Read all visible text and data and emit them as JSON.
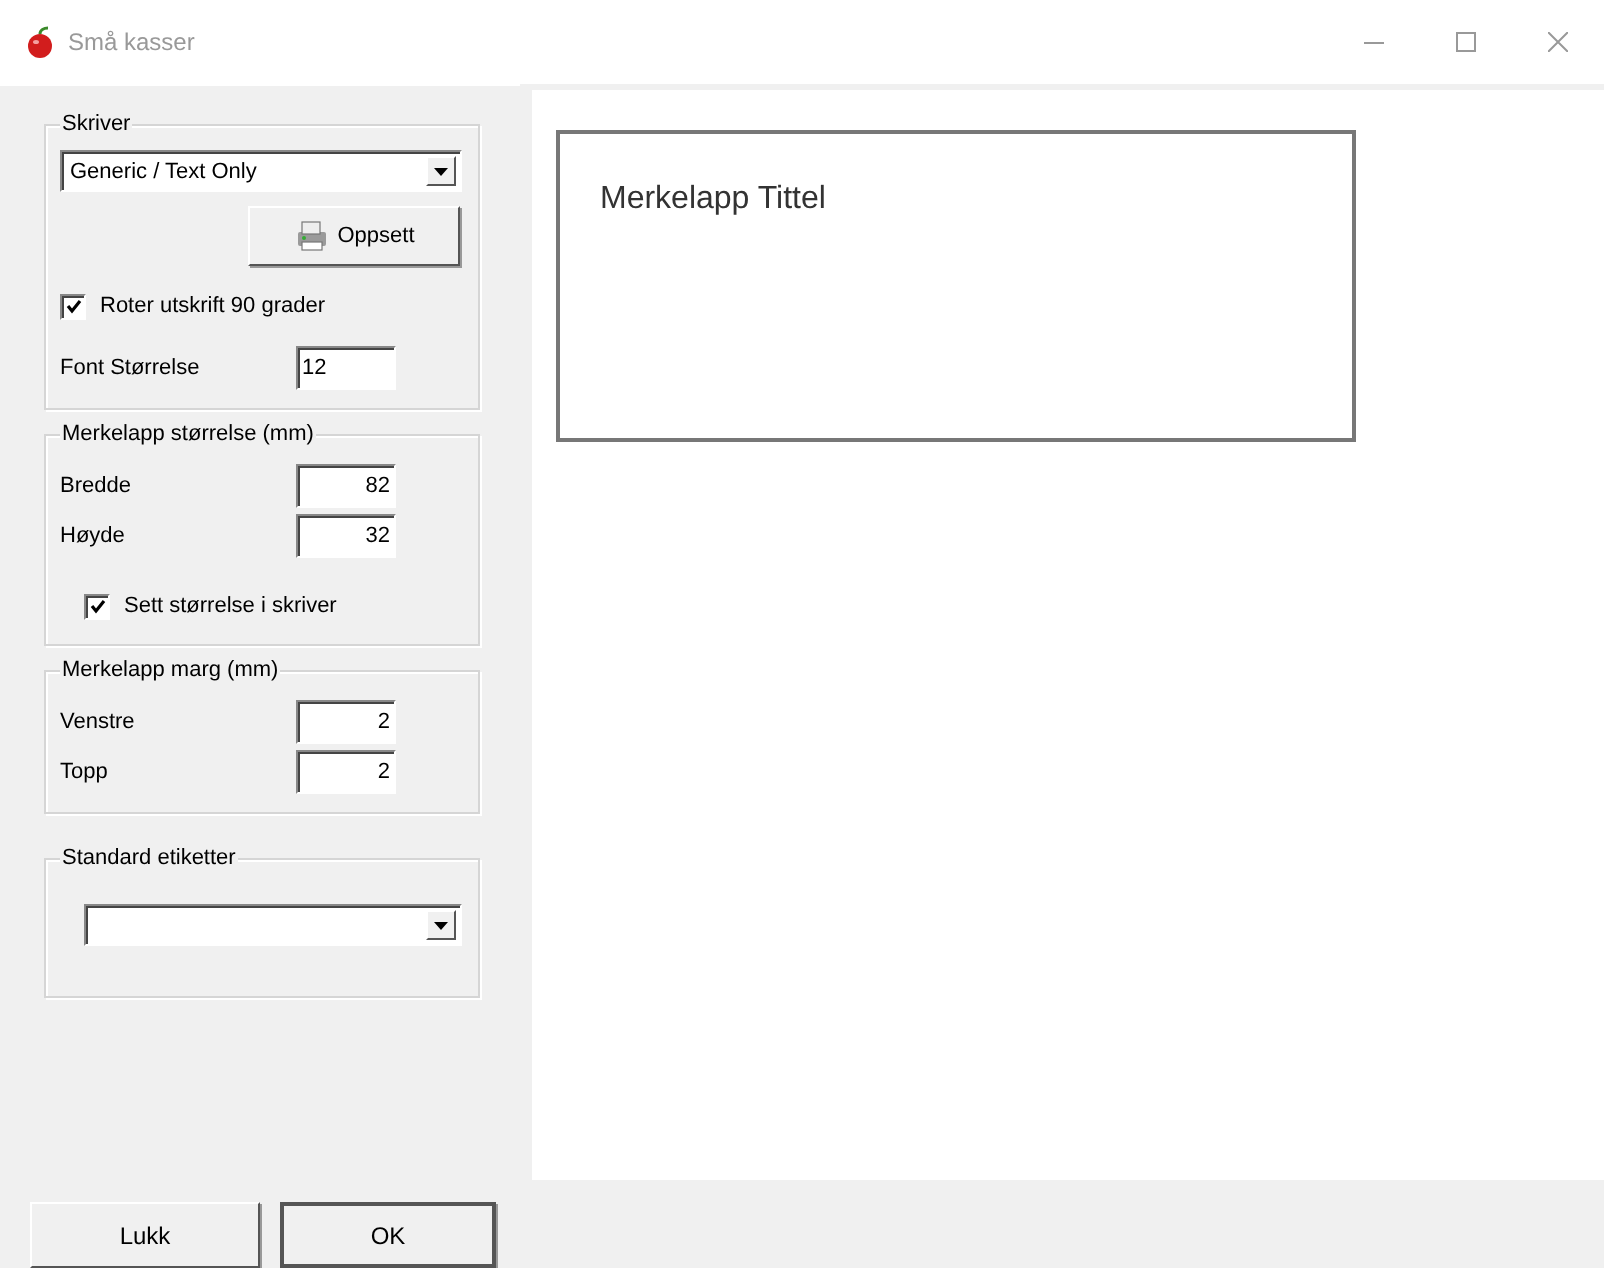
{
  "window": {
    "title": "Små kasser"
  },
  "printer_group": {
    "title": "Skriver",
    "printer": {
      "value": "Generic / Text Only"
    },
    "setup_button": {
      "label": "Oppsett"
    },
    "rotate": {
      "label": "Roter utskrift 90 grader",
      "checked": true
    },
    "font_size": {
      "label": "Font Størrelse",
      "value": "12"
    }
  },
  "size_group": {
    "title": "Merkelapp størrelse (mm)",
    "fields": [
      {
        "label": "Bredde",
        "value": "82"
      },
      {
        "label": "Høyde",
        "value": "32"
      }
    ],
    "set_in_printer": {
      "label": "Sett størrelse i skriver",
      "checked": true
    }
  },
  "margin_group": {
    "title": "Merkelapp marg (mm)",
    "fields": [
      {
        "label": "Venstre",
        "value": "2"
      },
      {
        "label": "Topp",
        "value": "2"
      }
    ]
  },
  "standard_group": {
    "title": "Standard etiketter"
  },
  "preview": {
    "label_title": "Merkelapp Tittel"
  },
  "buttons": [
    {
      "label": "Lukk"
    },
    {
      "label": "OK"
    }
  ]
}
